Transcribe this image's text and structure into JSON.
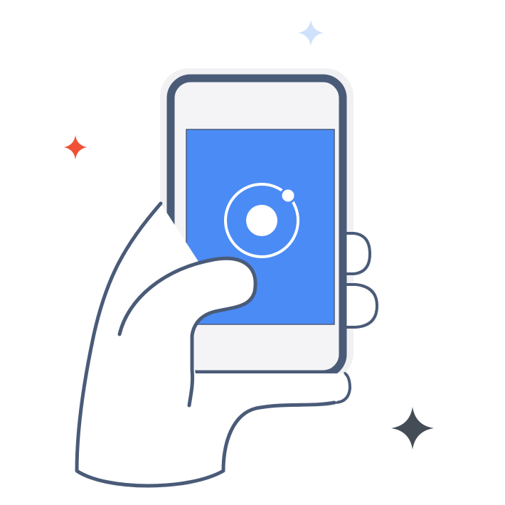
{
  "illustration": {
    "subject": "hand-holding-phone",
    "icons": {
      "app_logo": "ionic-logo-icon",
      "sparkles": [
        "sparkle-icon-blue",
        "sparkle-icon-red",
        "sparkle-icon-dark"
      ]
    },
    "colors": {
      "background": "#ffffff",
      "outline": "#4a5b78",
      "phone_bezel": "#f4f4f7",
      "phone_halo": "#f1f1f4",
      "screen": "#4b8bf5",
      "logo": "#ffffff",
      "hand_fill": "#ffffff",
      "sparkle_blue": "#cfe1fb",
      "sparkle_red": "#f05038",
      "sparkle_dark": "#444c55"
    }
  }
}
